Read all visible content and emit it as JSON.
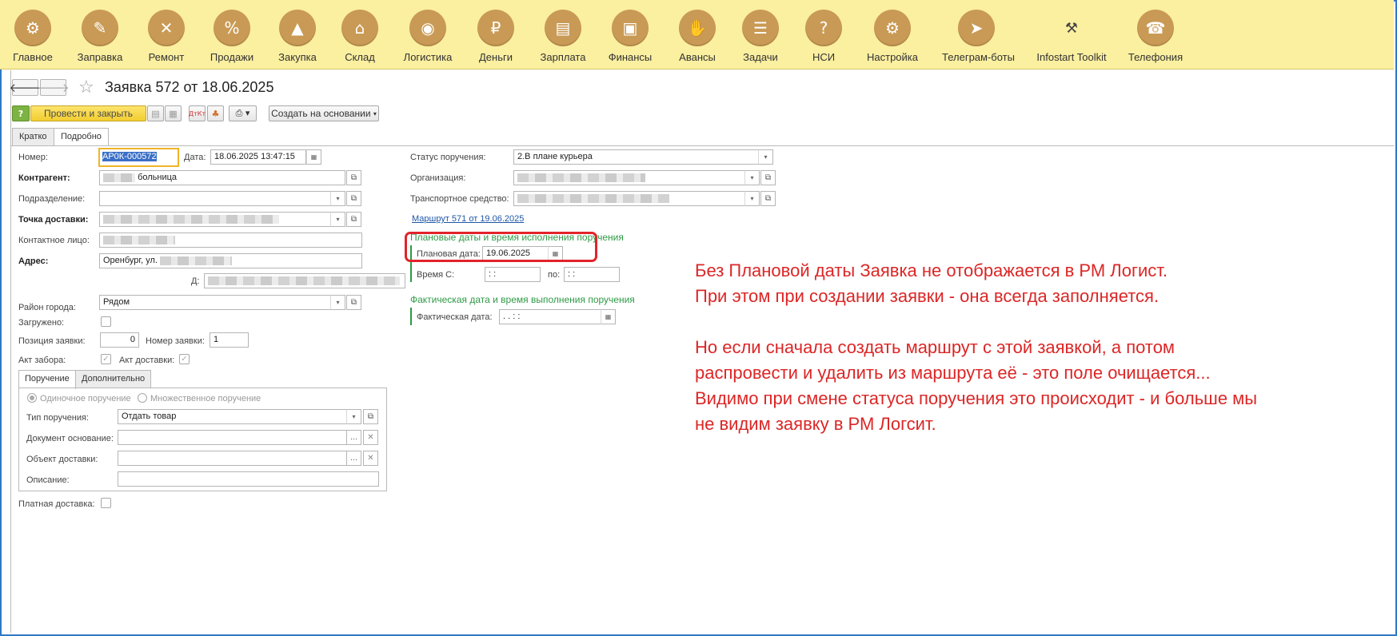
{
  "sections": [
    {
      "label": "Главное",
      "icon": "main-gears-icon"
    },
    {
      "label": "Заправка",
      "icon": "cartridge-refill-icon"
    },
    {
      "label": "Ремонт",
      "icon": "repair-tools-icon"
    },
    {
      "label": "Продажи",
      "icon": "sales-bag-icon"
    },
    {
      "label": "Закупка",
      "icon": "purchase-cart-icon"
    },
    {
      "label": "Склад",
      "icon": "warehouse-icon"
    },
    {
      "label": "Логистика",
      "icon": "logistics-map-icon"
    },
    {
      "label": "Деньги",
      "icon": "money-bag-icon"
    },
    {
      "label": "Зарплата",
      "icon": "salary-wallet-icon"
    },
    {
      "label": "Финансы",
      "icon": "finance-briefcase-icon"
    },
    {
      "label": "Авансы",
      "icon": "advance-hand-icon"
    },
    {
      "label": "Задачи",
      "icon": "tasks-list-icon"
    },
    {
      "label": "НСИ",
      "icon": "reference-book-icon"
    },
    {
      "label": "Настройка",
      "icon": "settings-gear-icon"
    },
    {
      "label": "Телеграм-боты",
      "icon": "telegram-plane-icon"
    },
    {
      "label": "Infostart Toolkit",
      "icon": "toolkit-icon"
    },
    {
      "label": "Телефония",
      "icon": "telephone-icon"
    }
  ],
  "header": {
    "title": "Заявка 572 от 18.06.2025"
  },
  "toolbar": {
    "help_label": "?",
    "post_close_label": "Провести и закрыть",
    "create_based_label": "Создать на основании"
  },
  "tabs": [
    "Кратко",
    "Подробно"
  ],
  "form": {
    "number_label": "Номер:",
    "number_value": "АР0К-000572",
    "date_label": "Дата:",
    "date_value": "18.06.2025 13:47:15",
    "counterparty_label": "Контрагент:",
    "counterparty_value": "больница",
    "department_label": "Подразделение:",
    "delivery_point_label": "Точка доставки:",
    "contact_label": "Контактное лицо:",
    "address_label": "Адрес:",
    "address_value": "Оренбург, ул.",
    "house_label": "Д:",
    "district_label": "Район города:",
    "district_value": "Рядом",
    "loaded_label": "Загружено:",
    "position_label": "Позиция заявки:",
    "position_value": "0",
    "request_number_label": "Номер заявки:",
    "request_number_value": "1",
    "pickup_act_label": "Акт забора:",
    "delivery_act_label": "Акт доставки:",
    "inner_tabs": [
      "Поручение",
      "Дополнительно"
    ],
    "single_order_label": "Одиночное поручение",
    "multiple_order_label": "Множественное поручение",
    "order_type_label": "Тип поручения:",
    "order_type_value": "Отдать товар",
    "base_document_label": "Документ основание:",
    "delivery_object_label": "Объект доставки:",
    "description_label": "Описание:",
    "paid_delivery_label": "Платная доставка:",
    "status_label": "Статус поручения:",
    "status_value": "2.В плане курьера",
    "organization_label": "Организация:",
    "vehicle_label": "Транспортное средство:",
    "route_link": "Маршрут 571 от 19.06.2025",
    "planned_group_title": "Плановые даты и время исполнения поручения",
    "planned_date_label": "Плановая дата:",
    "planned_date_value": "19.06.2025",
    "time_from_label": "Время С:",
    "time_from_value": ":  :",
    "time_to_label": "по:",
    "time_to_value": ":  :",
    "actual_group_title": "Фактическая дата и время выполнения поручения",
    "actual_date_label": "Фактическая дата:",
    "actual_date_value": ".  .     :  :"
  },
  "annotation": {
    "text": "Без Плановой даты Заявка не отображается в РМ Логист.\nПри этом при создании заявки - она всегда заполняется.\n\nНо если сначала создать маршрут с этой заявкой, а потом\nраспровести и удалить из маршрута её - это поле очищается...\nВидимо при смене статуса поручения это происходит - и больше мы\nне видим заявку в РМ Логсит.",
    "color": "#dc2626"
  },
  "colors": {
    "topbar": "#fbefa0",
    "accent_green": "#2e9a45",
    "primary_button": "#f2cd30",
    "link": "#1d56a8"
  }
}
